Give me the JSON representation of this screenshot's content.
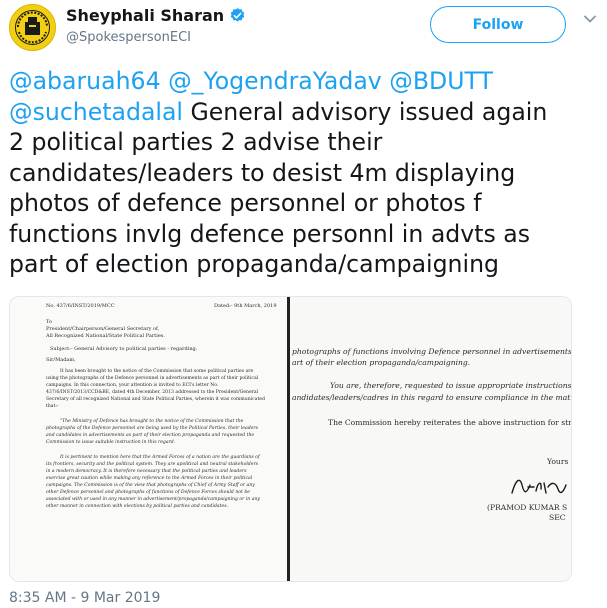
{
  "author": {
    "display_name": "Sheyphali Sharan",
    "handle": "@SpokespersonECI",
    "verified": true
  },
  "follow_button": {
    "label": "Follow"
  },
  "tweet": {
    "mentions": [
      "@abaruah64",
      "@_YogendraYadav",
      "@BDUTT",
      "@suchetadalal"
    ],
    "line1": "@abaruah64 @_YogendraYadav @BDUTT",
    "line2_mention": "@suchetadalal",
    "line2_text": " General advisory issued again",
    "line3": "2 political parties 2 advise their",
    "line4": "candidates/leaders to desist 4m displaying",
    "line5": "photos of defence personnel or photos f",
    "line6": "functions invlg defence personnl in advts as",
    "line7": "part of election propaganda/campaigning"
  },
  "document_left": {
    "ref_no": "No. 437/6/INST/2019/MCC",
    "dated": "Dated:- 9th March, 2019",
    "to": "To",
    "addressee_1": "President/Chairperson/General Secretary of,",
    "addressee_2": "All Recognized National/State Political Parties.",
    "subject": "Subject:- General Advisory to political parties - regarding.",
    "salutation": "Sir/Madam,",
    "para1": [
      "It has been brought to the notice of the Commission that some political parties are",
      "using the photographs of the Defence personnel in advertisements as part of their political",
      "campaigns.   In this connection, your attention is invited to ECI's letter No.",
      "437/6/INST/2013/CCD&BE, dated 4th December, 2013 addressed to the President/General",
      "Secretary of all recognized National and State Political Parties, wherein it was communicated",
      "that:-"
    ],
    "quote1": [
      "\"The Ministry of Defence has brought to the notice of the Commission that the",
      "photographs of the Defence personnel are being used by the Political Parties, their leaders",
      "and candidates in advertisements as part of their election propaganda and requested the",
      "Commission to issue suitable instruction in this regard."
    ],
    "quote2": [
      "It is pertinent to mention here that the Armed Forces of a nation are the guardians of",
      "its frontiers, security and the political system.  They are apolitical and neutral stakeholders",
      "in a modern democracy.  It is therefore necessary that the political parties and leaders",
      "exercise great caution while making any reference to the Armed Forces in their political",
      "campaigns.  The Commission is of the view that photographs of Chief of Army Staff or any",
      "other Defence personnel and photographs of functions of Defence Forces should not be",
      "associated with or used in any manner in advertisement/propaganda/campaigning or in any",
      "other manner in connection with elections by political parties and candidates."
    ]
  },
  "document_right": {
    "line1": "photographs of functions involving Defence personnel in advertisements, or ot",
    "line2": "art of their election propaganda/campaigning.",
    "para_a": "You   are,   therefore,   requested   to   issue   appropriate   instructions",
    "para_b": "andidates/leaders/cadres in this regard to ensure compliance in the matter.\"",
    "para_c": "The Commission hereby reiterates the above instruction for strict complianc",
    "closing": "Yours",
    "signature_name": "(PRAMOD KUMAR S",
    "signature_title": "SEC"
  },
  "timestamp": "8:35 AM - 9 Mar 2019",
  "colors": {
    "accent": "#1da1f2",
    "text": "#14171a",
    "muted": "#657786",
    "avatar_bg": "#f2cf12"
  },
  "icons": [
    "verified-badge-icon",
    "chevron-down-icon"
  ]
}
